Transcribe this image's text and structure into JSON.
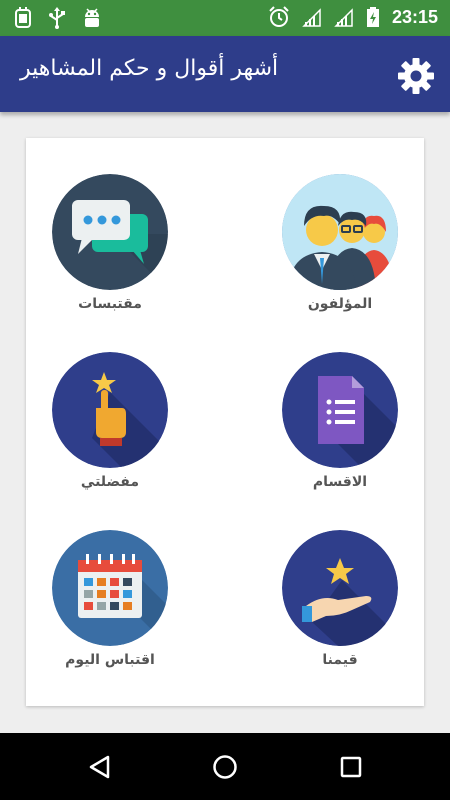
{
  "status_bar": {
    "time": "23:15",
    "left_icons": [
      "android-debug-icon",
      "usb-icon",
      "android-icon"
    ],
    "right_icons": [
      "alarm-icon",
      "signal-icon",
      "signal-icon",
      "battery-charging-icon"
    ]
  },
  "app_bar": {
    "title": "أشهر أقوال و حكم المشاهير",
    "settings_icon": "gear-icon",
    "background": "#2e3d8a"
  },
  "tiles": [
    {
      "id": "authors",
      "label": "المؤلفون",
      "icon": "people-icon",
      "circle_color": "#2f3e8b"
    },
    {
      "id": "quotes",
      "label": "مقتبسات",
      "icon": "chat-bubbles-icon",
      "circle_color": "#34495e"
    },
    {
      "id": "categories",
      "label": "الاقسام",
      "icon": "document-list-icon",
      "circle_color": "#2f3e8b"
    },
    {
      "id": "favorites",
      "label": "مفضلتي",
      "icon": "hand-star-icon",
      "circle_color": "#2f3e8b"
    },
    {
      "id": "rate",
      "label": "قيمنا",
      "icon": "hand-star-icon",
      "circle_color": "#2f3e8b"
    },
    {
      "id": "quote_of_day",
      "label": "اقتباس اليوم",
      "icon": "calendar-icon",
      "circle_color": "#2f3e8b"
    }
  ],
  "nav_bar": {
    "back_icon": "back-triangle-icon",
    "home_icon": "home-circle-icon",
    "recents_icon": "recents-square-icon"
  },
  "colors": {
    "status_bar": "#3f8f3f",
    "accent_blue": "#2e3d8a",
    "label_text": "#555555"
  }
}
